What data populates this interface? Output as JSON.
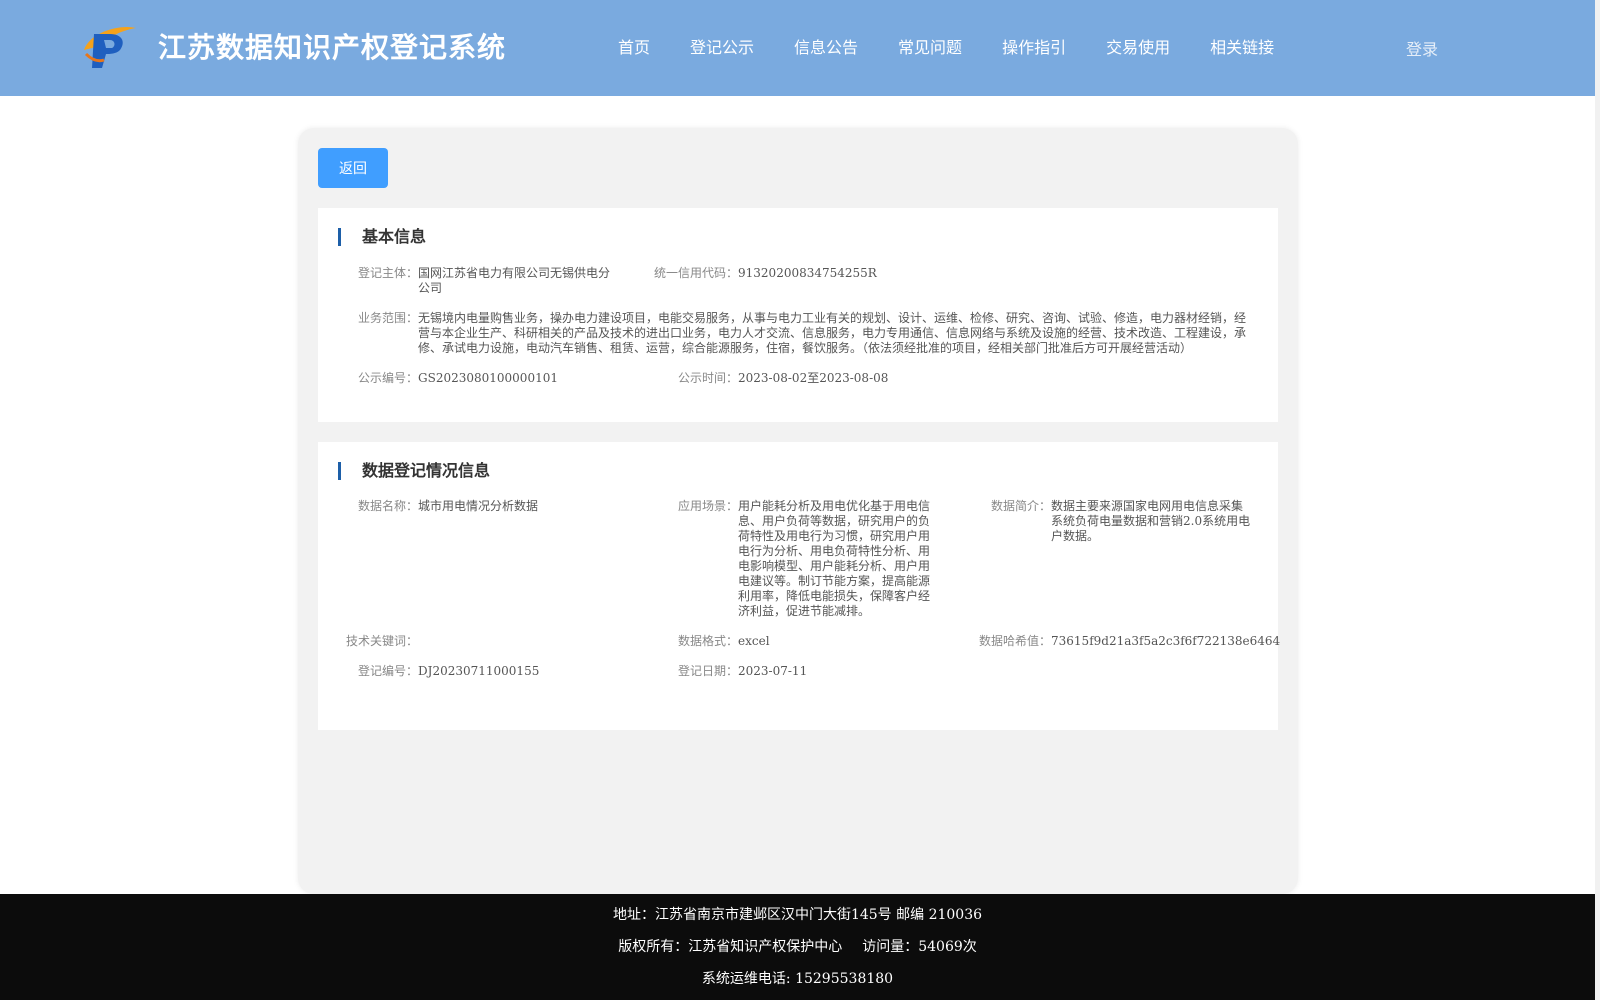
{
  "header": {
    "title": "江苏数据知识产权登记系统",
    "nav": [
      "首页",
      "登记公示",
      "信息公告",
      "常见问题",
      "操作指引",
      "交易使用",
      "相关链接"
    ],
    "login": "登录",
    "colors": {
      "bar": "#7aaadf"
    }
  },
  "back_label": "返回",
  "basic": {
    "title": "基本信息",
    "subject_label": "登记主体：",
    "subject": "国网江苏省电力有限公司无锡供电分公司",
    "credit_label": "统一信用代码：",
    "credit": "91320200834754255R",
    "scope_label": "业务范围：",
    "scope": "无锡境内电量购售业务，操办电力建设项目，电能交易服务，从事与电力工业有关的规划、设计、运维、检修、研究、咨询、试验、修造，电力器材经销，经营与本企业生产、科研相关的产品及技术的进出口业务，电力人才交流、信息服务，电力专用通信、信息网络与系统及设施的经营、技术改造、工程建设，承修、承试电力设施，电动汽车销售、租赁、运营，综合能源服务，住宿，餐饮服务。（依法须经批准的项目，经相关部门批准后方可开展经营活动）",
    "pub_no_label": "公示编号：",
    "pub_no": "GS2023080100000101",
    "pub_time_label": "公示时间：",
    "pub_time": "2023-08-02至2023-08-08"
  },
  "data_info": {
    "title": "数据登记情况信息",
    "name_label": "数据名称：",
    "name": "城市用电情况分析数据",
    "scene_label": "应用场景：",
    "scene": "用户能耗分析及用电优化基于用电信息、用户负荷等数据，研究用户的负荷特性及用电行为习惯，研究用户用电行为分析、用电负荷特性分析、用电影响模型、用户能耗分析、用户用电建议等。制订节能方案，提高能源利用率，降低电能损失，保障客户经济利益，促进节能减排。",
    "intro_label": "数据简介：",
    "intro": "数据主要来源国家电网用电信息采集系统负荷电量数据和营销2.0系统用电户数据。",
    "keyword_label": "技术关键词：",
    "keyword": "",
    "format_label": "数据格式：",
    "format": "excel",
    "hash_label": "数据哈希值：",
    "hash": "73615f9d21a3f5a2c3f6f722138e6464",
    "reg_no_label": "登记编号：",
    "reg_no": "DJ20230711000155",
    "reg_date_label": "登记日期：",
    "reg_date": "2023-07-11"
  },
  "footer": {
    "address": "地址：江苏省南京市建邺区汉中门大街145号 邮编 210036",
    "copyright": "版权所有：江苏省知识产权保护中心",
    "visits": "访问量：54069次",
    "phone": "系统运维电话: 15295538180"
  }
}
